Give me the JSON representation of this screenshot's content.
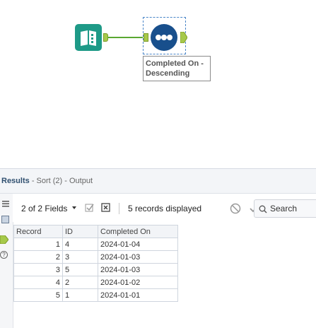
{
  "canvas": {
    "annotation": "Completed On - Descending"
  },
  "results": {
    "title": "Results",
    "subtitle": "- Sort (2) - Output",
    "toolbar": {
      "fields_label": "2 of 2 Fields",
      "records_label": "5 records displayed",
      "search_label": "Search"
    },
    "table": {
      "columns": [
        "Record",
        "ID",
        "Completed On"
      ],
      "rows": [
        [
          "1",
          "4",
          "2024-01-04"
        ],
        [
          "2",
          "3",
          "2024-01-03"
        ],
        [
          "3",
          "5",
          "2024-01-03"
        ],
        [
          "4",
          "2",
          "2024-01-02"
        ],
        [
          "5",
          "1",
          "2024-01-01"
        ]
      ]
    }
  },
  "colors": {
    "input_tool": "#1e9a87",
    "sort_tool": "#184f8c",
    "anchor": "#a6c94a",
    "connector": "#5aa832"
  },
  "icons": [
    "book-input-icon",
    "sort-dots-icon",
    "list-icon",
    "table-icon",
    "output-anchor-icon",
    "help-icon",
    "checkbox-icon",
    "clear-icon",
    "cancel-icon",
    "check-icon",
    "search-icon",
    "chevron-down-icon"
  ]
}
